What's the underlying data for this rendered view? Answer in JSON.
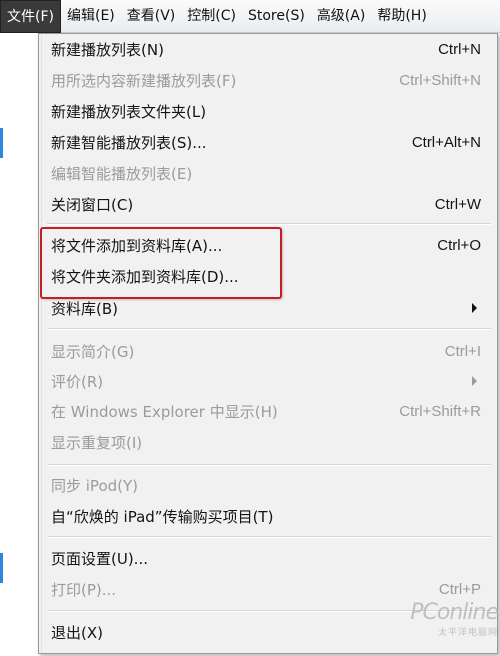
{
  "menubar": {
    "items": [
      "文件(F)",
      "编辑(E)",
      "查看(V)",
      "控制(C)",
      "Store(S)",
      "高级(A)",
      "帮助(H)"
    ]
  },
  "menu": {
    "items": [
      {
        "label": "新建播放列表(N)",
        "shortcut": "Ctrl+N",
        "disabled": false
      },
      {
        "label": "用所选内容新建播放列表(F)",
        "shortcut": "Ctrl+Shift+N",
        "disabled": true
      },
      {
        "label": "新建播放列表文件夹(L)",
        "shortcut": "",
        "disabled": false
      },
      {
        "label": "新建智能播放列表(S)...",
        "shortcut": "Ctrl+Alt+N",
        "disabled": false
      },
      {
        "label": "编辑智能播放列表(E)",
        "shortcut": "",
        "disabled": true
      },
      {
        "label": "关闭窗口(C)",
        "shortcut": "Ctrl+W",
        "disabled": false
      },
      {
        "label": "将文件添加到资料库(A)...",
        "shortcut": "Ctrl+O",
        "disabled": false
      },
      {
        "label": "将文件夹添加到资料库(D)...",
        "shortcut": "",
        "disabled": false
      },
      {
        "label": "资料库(B)",
        "shortcut": "",
        "disabled": false,
        "submenu": true
      },
      {
        "label": "显示简介(G)",
        "shortcut": "Ctrl+I",
        "disabled": true
      },
      {
        "label": "评价(R)",
        "shortcut": "",
        "disabled": true,
        "submenu": true
      },
      {
        "label": "在 Windows Explorer 中显示(H)",
        "shortcut": "Ctrl+Shift+R",
        "disabled": true
      },
      {
        "label": "显示重复项(I)",
        "shortcut": "",
        "disabled": true
      },
      {
        "label": "同步 iPod(Y)",
        "shortcut": "",
        "disabled": true
      },
      {
        "label": "自“欣焕的 iPad”传输购买项目(T)",
        "shortcut": "",
        "disabled": false
      },
      {
        "label": "页面设置(U)...",
        "shortcut": "",
        "disabled": false
      },
      {
        "label": "打印(P)...",
        "shortcut": "Ctrl+P",
        "disabled": true
      },
      {
        "label": "退出(X)",
        "shortcut": "",
        "disabled": false
      }
    ]
  },
  "watermark": {
    "logo": "PConline",
    "sub": "太平洋电脑网"
  },
  "colors": {
    "highlight_box": "#c21e23",
    "active_menu_bg": "#3a3a3a",
    "disabled_text": "#9b9b9b"
  }
}
